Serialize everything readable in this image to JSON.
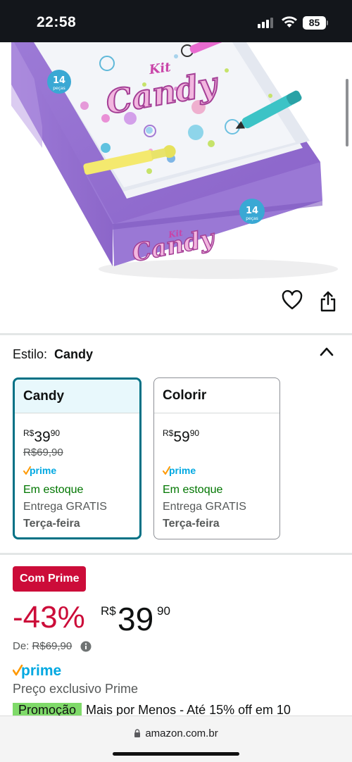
{
  "status_bar": {
    "time": "22:58",
    "battery": "85"
  },
  "product_image": {
    "box_title_small": "Kit",
    "box_title": "Candy",
    "badge_number": "14",
    "badge_word": "peças"
  },
  "style": {
    "label": "Estilo:",
    "value": "Candy"
  },
  "options": [
    {
      "name": "Candy",
      "currency": "R$",
      "whole": "39",
      "cents": "90",
      "list_price": "R$69,90",
      "prime": "prime",
      "stock": "Em estoque",
      "delivery": "Entrega GRATIS",
      "day": "Terça-feira"
    },
    {
      "name": "Colorir",
      "currency": "R$",
      "whole": "59",
      "cents": "90",
      "prime": "prime",
      "stock": "Em estoque",
      "delivery": "Entrega GRATIS",
      "day": "Terça-feira"
    }
  ],
  "deal": {
    "badge": "Com Prime",
    "discount": "-43%",
    "currency": "R$",
    "whole": "39",
    "cents": "90",
    "list_label": "De:",
    "list_price": "R$69,90",
    "prime": "prime",
    "exclusive": "Preço exclusivo Prime",
    "promo_tag": "Promoção",
    "promo_text": "Mais por Menos - Até 15% off em 10"
  },
  "browser": {
    "url": "amazon.com.br"
  },
  "colors": {
    "accent_teal": "#007185",
    "deal_red": "#cc0c39",
    "stock_green": "#007600",
    "prime_blue": "#00a8e1",
    "prime_orange": "#ff9900",
    "promo_green": "#7fda69"
  }
}
